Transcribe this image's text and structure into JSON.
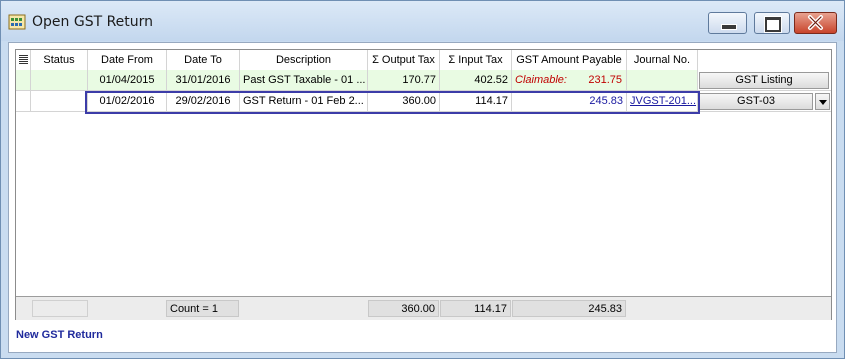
{
  "window": {
    "title": "Open GST Return"
  },
  "columns": [
    "Status",
    "Date From",
    "Date To",
    "Description",
    "Σ Output Tax",
    "Σ Input Tax",
    "GST Amount Payable",
    "Journal No."
  ],
  "rows": [
    {
      "status": "",
      "date_from": "01/04/2015",
      "date_to": "31/01/2016",
      "description": "Past GST Taxable - 01 ...",
      "output_tax": "170.77",
      "input_tax": "402.52",
      "payable_label": "Claimable:",
      "payable": "231.75",
      "journal": "",
      "action": "GST Listing"
    },
    {
      "status": "",
      "date_from": "01/02/2016",
      "date_to": "29/02/2016",
      "description": "GST Return - 01 Feb 2...",
      "output_tax": "360.00",
      "input_tax": "114.17",
      "payable_label": "",
      "payable": "245.83",
      "journal": "JVGST-201...",
      "action": "GST-03"
    }
  ],
  "footer": {
    "count": "Count = 1",
    "output_tax": "360.00",
    "input_tax": "114.17",
    "payable": "245.83"
  },
  "actions": {
    "new_return": "New GST Return"
  },
  "colors": {
    "selection_border": "#3c3ca8",
    "claimable": "#c00000",
    "link": "#1a1aa0",
    "row_highlight": "#e9fbe3"
  }
}
